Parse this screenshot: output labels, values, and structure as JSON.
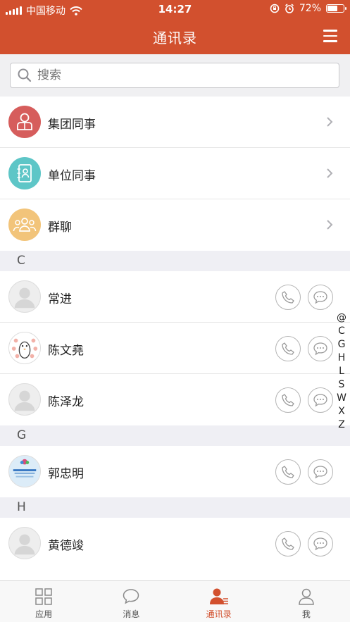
{
  "status_bar": {
    "carrier": "中国移动",
    "time": "14:27",
    "battery": "72%",
    "battery_level": 0.72
  },
  "header": {
    "title": "通讯录"
  },
  "search": {
    "placeholder": "搜索"
  },
  "groups": [
    {
      "label": "集团同事",
      "icon": "person-badge-icon",
      "color": "#d65d5c"
    },
    {
      "label": "单位同事",
      "icon": "address-book-icon",
      "color": "#5ec6c7"
    },
    {
      "label": "群聊",
      "icon": "group-people-icon",
      "color": "#f2c47a"
    }
  ],
  "sections": [
    {
      "letter": "C",
      "contacts": [
        "常进",
        "陈文堯",
        "陈泽龙"
      ]
    },
    {
      "letter": "G",
      "contacts": [
        "郭忠明"
      ]
    },
    {
      "letter": "H",
      "contacts": [
        "黄德竣"
      ]
    }
  ],
  "index_letters": [
    "@",
    "C",
    "G",
    "H",
    "L",
    "S",
    "W",
    "X",
    "Z"
  ],
  "tabs": [
    {
      "label": "应用",
      "icon": "grid-icon",
      "active": false
    },
    {
      "label": "消息",
      "icon": "chat-bubble-icon",
      "active": false
    },
    {
      "label": "通讯录",
      "icon": "contacts-icon",
      "active": true
    },
    {
      "label": "我",
      "icon": "user-icon",
      "active": false
    }
  ],
  "colors": {
    "brand": "#d2502e",
    "divider": "#e6e6e6"
  }
}
